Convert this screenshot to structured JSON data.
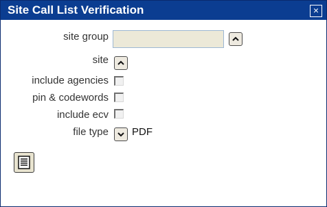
{
  "dialog": {
    "title": "Site Call List Verification",
    "close_icon": "close-icon",
    "close_glyph": "×"
  },
  "form": {
    "site_group": {
      "label": "site group",
      "value": "",
      "button_icon": "chevron-up-icon"
    },
    "site": {
      "label": "site",
      "button_icon": "chevron-up-icon"
    },
    "include_agencies": {
      "label": "include agencies",
      "checked": false
    },
    "pin_codewords": {
      "label": "pin & codewords",
      "checked": false
    },
    "include_ecv": {
      "label": "include ecv",
      "checked": false
    },
    "file_type": {
      "label": "file type",
      "value": "PDF",
      "button_icon": "chevron-down-icon"
    }
  },
  "actions": {
    "report_icon": "document-list-icon"
  },
  "colors": {
    "titlebar": "#0b3d91",
    "input_bg": "#ece9d8",
    "button_bg": "#eeeae0"
  }
}
